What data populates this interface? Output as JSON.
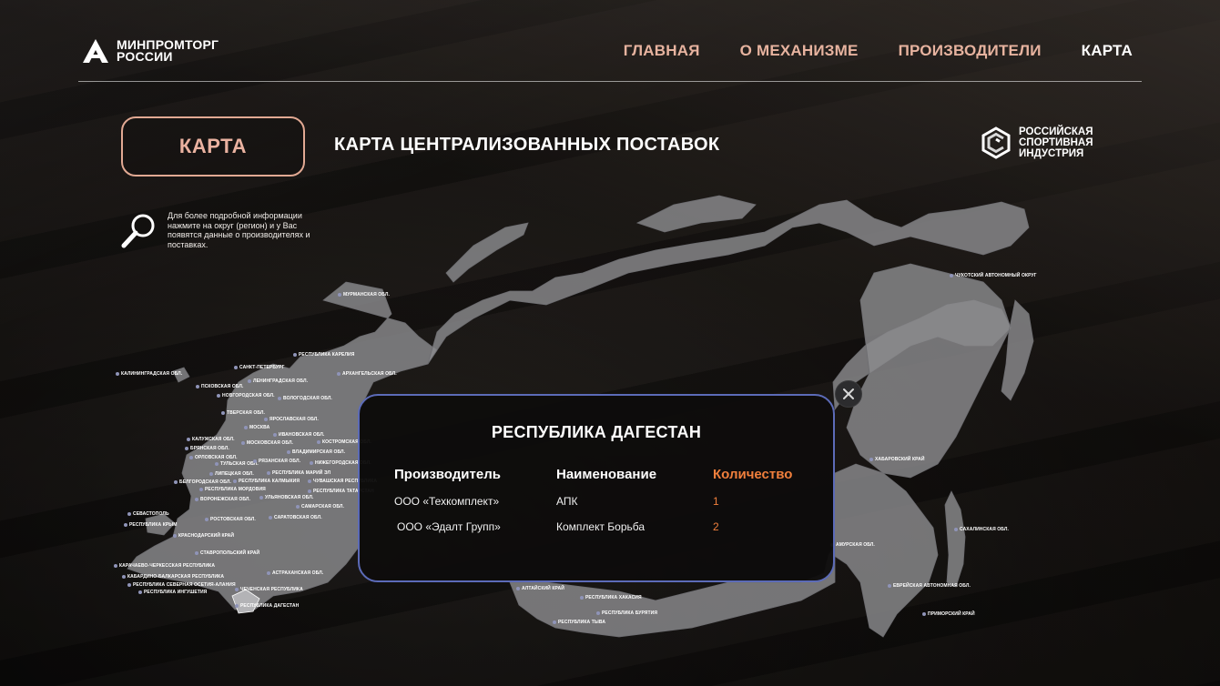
{
  "header": {
    "logo_line1": "МИНПРОМТОРГ",
    "logo_line2": "РОССИИ",
    "nav": [
      {
        "label": "ГЛАВНАЯ"
      },
      {
        "label": "О МЕХАНИЗМЕ"
      },
      {
        "label": "ПРОИЗВОДИТЕЛИ"
      },
      {
        "label": "КАРТА"
      }
    ],
    "active_nav": "КАРТА"
  },
  "section_button": "КАРТА",
  "page_title": "КАРТА ЦЕНТРАЛИЗОВАННЫХ ПОСТАВОК",
  "partner_logo": {
    "line1": "РОССИЙСКАЯ",
    "line2": "СПОРТИВНАЯ",
    "line3": "ИНДУСТРИЯ"
  },
  "hint": "Для более подробной информации нажмите на округ (регион) и у Вас появятся данные о производителях и поставках.",
  "map_regions": [
    "МУРМАНСКАЯ ОБЛ.",
    "РЕСПУБЛИКА КАРЕЛИЯ",
    "КАЛИНИНГРАДСКАЯ ОБЛ.",
    "САНКТ-ПЕТЕРБУРГ",
    "ЛЕНИНГРАДСКАЯ ОБЛ.",
    "АРХАНГЕЛЬСКАЯ ОБЛ.",
    "ПСКОВСКАЯ ОБЛ.",
    "НОВГОРОДСКАЯ ОБЛ.",
    "ВОЛОГОДСКАЯ ОБЛ.",
    "ТВЕРСКАЯ ОБЛ.",
    "ЯРОСЛАВСКАЯ ОБЛ.",
    "МОСКВА",
    "ИВАНОВСКАЯ ОБЛ.",
    "КАЛУЖСКАЯ ОБЛ.",
    "МОСКОВСКАЯ ОБЛ.",
    "КОСТРОМСКАЯ ОБЛ.",
    "БРЯНСКАЯ ОБЛ.",
    "ВЛАДИМИРСКАЯ ОБЛ.",
    "ОРЛОВСКАЯ ОБЛ.",
    "ТУЛЬСКАЯ ОБЛ.",
    "РЯЗАНСКАЯ ОБЛ.",
    "НИЖЕГОРОДСКАЯ ОБЛ.",
    "ЛИПЕЦКАЯ ОБЛ.",
    "РЕСПУБЛИКА МАРИЙ ЭЛ",
    "БЕЛГОРОДСКАЯ ОБЛ.",
    "РЕСПУБЛИКА КАЛМЫКИЯ",
    "ЧУВАШСКАЯ РЕСПУБЛИКА",
    "РЕСПУБЛИКА МОРДОВИЯ",
    "РЕСПУБЛИКА ТАТАРСТАН",
    "ВОРОНЕЖСКАЯ ОБЛ.",
    "УЛЬЯНОВСКАЯ ОБЛ.",
    "САМАРСКАЯ ОБЛ.",
    "СЕВАСТОПОЛЬ",
    "РОСТОВСКАЯ ОБЛ.",
    "САРАТОВСКАЯ ОБЛ.",
    "РЕСПУБЛИКА КРЫМ",
    "КРАСНОДАРСКИЙ КРАЙ",
    "СТАВРОПОЛЬСКИЙ КРАЙ",
    "КАРАЧАЕВО-ЧЕРКЕССКАЯ РЕСПУБЛИКА",
    "АСТРАХАНСКАЯ ОБЛ.",
    "КАБАРДИНО-БАЛКАРСКАЯ РЕСПУБЛИКА",
    "РЕСПУБЛИКА СЕВЕРНАЯ ОСЕТИЯ-АЛАНИЯ",
    "ЧЕЧЕНСКАЯ РЕСПУБЛИКА",
    "РЕСПУБЛИКА ИНГУШЕТИЯ",
    "РЕСПУБЛИКА ДАГЕСТАН",
    "АЛТАЙСКИЙ КРАЙ",
    "РЕСПУБЛИКА ХАКАСИЯ",
    "РЕСПУБЛИКА БУРЯТИЯ",
    "РЕСПУБЛИКА ТЫВА",
    "ЧУКОТСКИЙ АВТОНОМНЫЙ ОКРУГ",
    "ХАБАРОВСКИЙ КРАЙ",
    "САХАЛИНСКАЯ ОБЛ.",
    "АМУРСКАЯ ОБЛ.",
    "ЕВРЕЙСКАЯ АВТОНОМНАЯ ОБЛ.",
    "ПРИМОРСКИЙ КРАЙ"
  ],
  "popup": {
    "title": "РЕСПУБЛИКА ДАГЕСТАН",
    "columns": [
      "Производитель",
      "Наименование",
      "Количество"
    ],
    "rows": [
      {
        "producer": "ООО «Техкомплект»",
        "name": "АПК",
        "qty": "1"
      },
      {
        "producer": "ООО «Эдалт Групп»",
        "name": "Комплект Борьба",
        "qty": "2"
      }
    ]
  },
  "colors": {
    "nav_inactive": "#e7b39f",
    "accent_orange": "#f07f3c",
    "popup_border": "#5c6bb8",
    "map_fill": "#8a8a8c"
  }
}
